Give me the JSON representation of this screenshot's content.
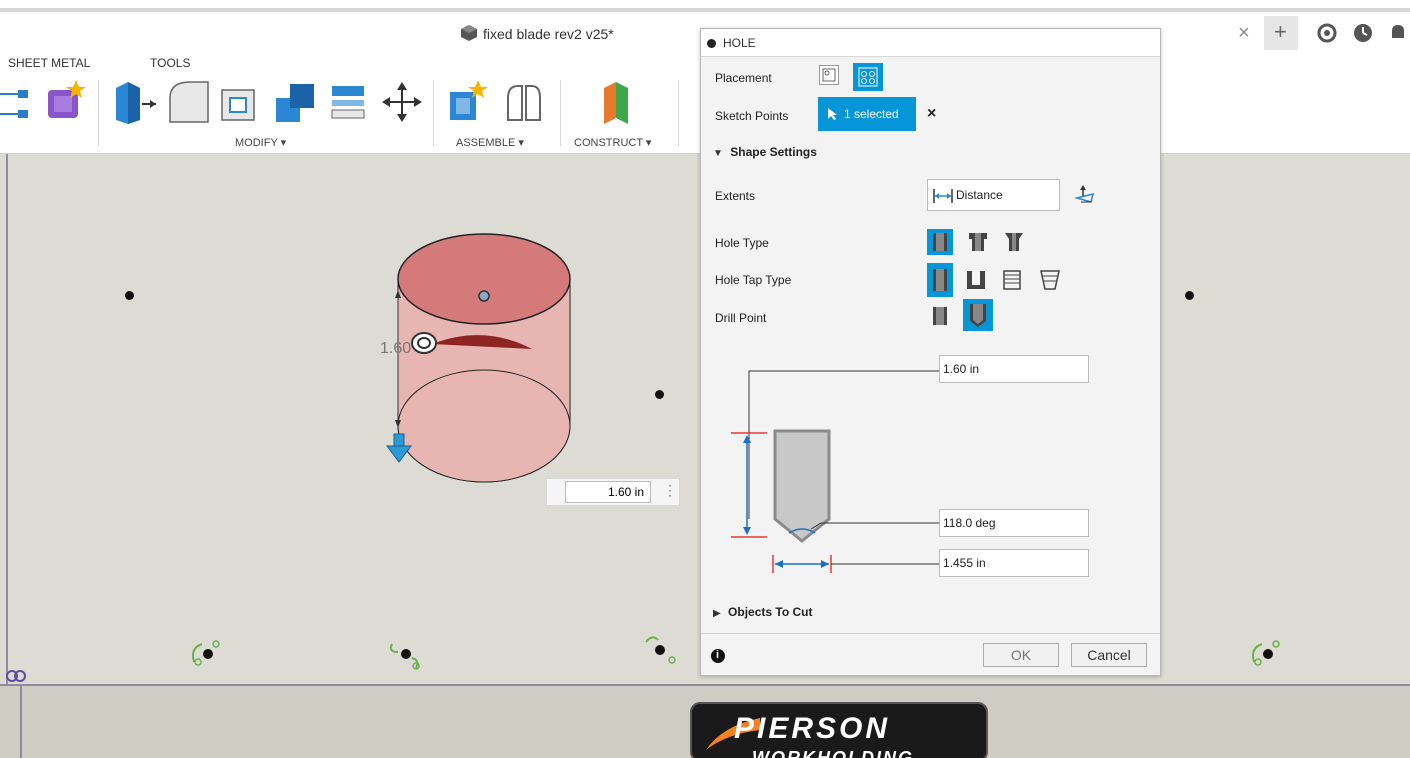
{
  "window": {
    "title": "fixed blade rev2 v25*"
  },
  "toolbar": {
    "tabs": [
      "SHEET METAL",
      "TOOLS"
    ],
    "groups": {
      "modify": "MODIFY ▾",
      "assemble": "ASSEMBLE ▾",
      "construct": "CONSTRUCT ▾"
    }
  },
  "window_controls": {
    "close": "×",
    "add": "+"
  },
  "viewport": {
    "dimension_label": "1.60",
    "depth_input_value": "1.60 in",
    "more_menu": "⋮"
  },
  "hole_dialog": {
    "title": "HOLE",
    "placement_label": "Placement",
    "sketch_points_label": "Sketch Points",
    "sketch_points_value": "1 selected",
    "clear_selection": "×",
    "shape_settings_label": "Shape Settings",
    "extents_label": "Extents",
    "extents_value": "Distance",
    "hole_type_label": "Hole Type",
    "hole_tap_type_label": "Hole Tap Type",
    "drill_point_label": "Drill Point",
    "depth_value": "1.60 in",
    "angle_value": "118.0 deg",
    "diameter_value": "1.455 in",
    "objects_to_cut_label": "Objects To Cut",
    "ok_label": "OK",
    "cancel_label": "Cancel",
    "info_icon_glyph": "i"
  },
  "logo": {
    "line1": "PIERSON",
    "line2": "WORKHOLDING"
  },
  "colors": {
    "accent": "#0696d7",
    "hole_fill": "#e4a7a7",
    "canvas": "#dcdcd4"
  }
}
